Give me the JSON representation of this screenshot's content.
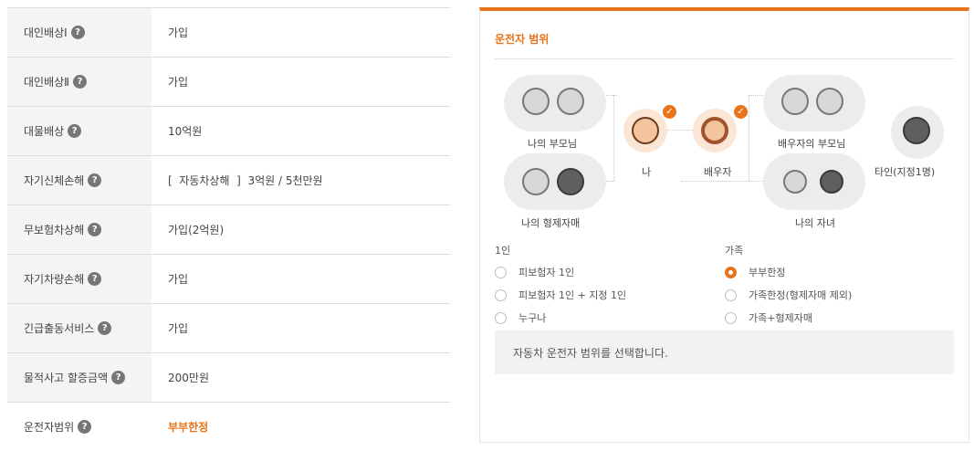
{
  "coverage": {
    "rows": [
      {
        "label": "대인배상Ⅰ",
        "value": "가입"
      },
      {
        "label": "대인배상Ⅱ",
        "value": "가입"
      },
      {
        "label": "대물배상",
        "value": "10억원"
      },
      {
        "label": "자기신체손해",
        "value": "[  자동차상해  ]  3억원 / 5천만원"
      },
      {
        "label": "무보험차상해",
        "value": "가입(2억원)"
      },
      {
        "label": "자기차량손해",
        "value": "가입"
      },
      {
        "label": "긴급출동서비스",
        "value": "가입"
      },
      {
        "label": "물적사고 할증금액",
        "value": "200만원"
      },
      {
        "label": "운전자범위",
        "value": "부부한정"
      }
    ],
    "help_glyph": "?"
  },
  "driver_range": {
    "title": "운전자 범위",
    "diagram": {
      "my_parents": "나의 부모님",
      "me": "나",
      "spouse": "배우자",
      "spouse_parents": "배우자의 부모님",
      "others": "타인(지정1명)",
      "my_siblings": "나의 형제자매",
      "my_children": "나의 자녀",
      "check_glyph": "✓"
    },
    "groups": {
      "single_label": "1인",
      "family_label": "가족"
    },
    "options_single": [
      {
        "label": "피보험자 1인",
        "selected": false
      },
      {
        "label": "피보험자 1인 + 지정 1인",
        "selected": false
      },
      {
        "label": "누구나",
        "selected": false
      }
    ],
    "options_family": [
      {
        "label": "부부한정",
        "selected": true
      },
      {
        "label": "가족한정(형제자매 제외)",
        "selected": false
      },
      {
        "label": "가족+형제자매",
        "selected": false
      }
    ],
    "info_text": "자동차 운전자 범위를 선택합니다."
  },
  "colors": {
    "accent": "#e8731a",
    "label_bg": "#f4f4f4",
    "help_icon": "#767676"
  }
}
